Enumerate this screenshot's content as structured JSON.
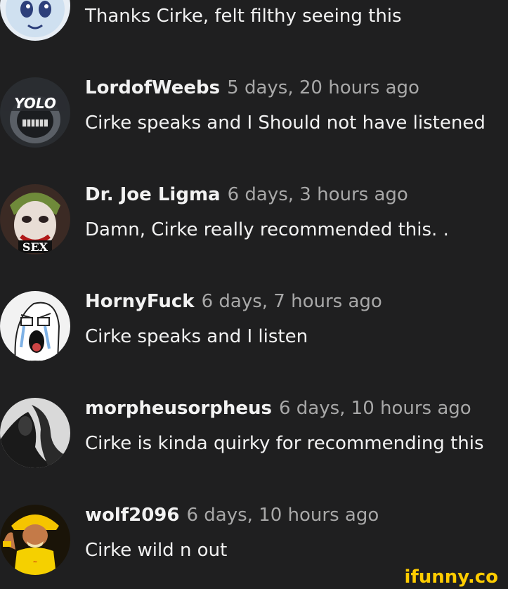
{
  "comments": [
    {
      "username": "",
      "time": "",
      "text": "Thanks Cirke, felt filthy seeing this",
      "avatar_icon": "blue-cartoon-creature-avatar"
    },
    {
      "username": "LordofWeebs",
      "time": "5 days, 20 hours ago",
      "text": "Cirke speaks and I Should not have listened",
      "avatar_icon": "yolo-mask-avatar",
      "avatar_text": "YOLO"
    },
    {
      "username": "Dr. Joe Ligma",
      "time": "6 days, 3 hours ago",
      "text": "Damn, Cirke really recommended this. .",
      "avatar_icon": "joker-face-avatar",
      "avatar_text": "SEX"
    },
    {
      "username": "HornyFuck",
      "time": "6 days, 7 hours ago",
      "text": "Cirke speaks and I listen",
      "avatar_icon": "crying-wojak-avatar"
    },
    {
      "username": "morpheusorpheus",
      "time": "6 days, 10 hours ago",
      "text": "Cirke is kinda quirky for recommending this",
      "avatar_icon": "dark-silhouette-avatar"
    },
    {
      "username": "wolf2096",
      "time": "6 days, 10 hours ago",
      "text": "Cirke wild n out",
      "avatar_icon": "wrestler-avatar"
    }
  ],
  "watermark": "ifunny.co",
  "colors": {
    "background": "#1f1f20",
    "username": "#f2f2f2",
    "timestamp": "#a8a8a8",
    "watermark": "#ffcc00"
  }
}
